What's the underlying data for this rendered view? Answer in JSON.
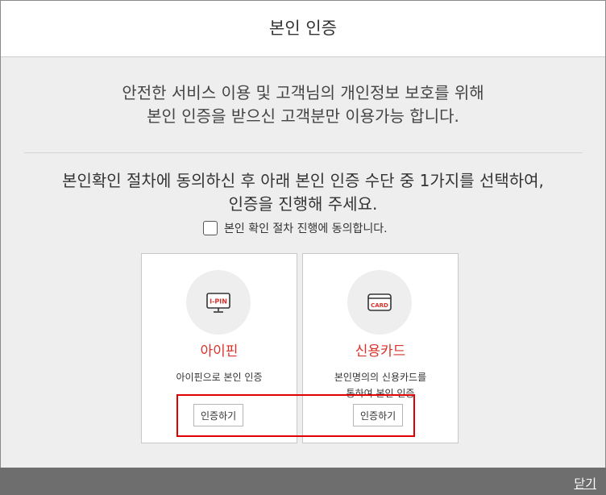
{
  "dialog": {
    "title": "본인 인증"
  },
  "intro": {
    "line1": "안전한 서비스 이용 및 고객님의 개인정보 보호를 위해",
    "line2": "본인 인증을 받으신 고객분만 이용가능 합니다."
  },
  "instruction": {
    "line1": "본인확인 절차에 동의하신 후 아래 본인 인증 수단 중 1가지를 선택하여,",
    "line2": "인증을 진행해 주세요."
  },
  "agreement": {
    "label": "본인 확인 절차 진행에 동의합니다.",
    "checked": false
  },
  "methods": [
    {
      "icon": "ipin-icon",
      "icon_text": "I-PIN",
      "name": "아이핀",
      "desc_line1": "아이핀으로 본인 인증",
      "desc_line2": "",
      "button": "인증하기"
    },
    {
      "icon": "credit-card-icon",
      "icon_text": "CARD",
      "name": "신용카드",
      "desc_line1": "본인명의의 신용카드를",
      "desc_line2": "통하여 본인 인증",
      "button": "인증하기"
    }
  ],
  "footer": {
    "close": "닫기"
  },
  "colors": {
    "accent": "#d9322b",
    "highlight": "#e00000",
    "footer_bg": "#6e6e6e",
    "page_bg": "#eeeeee"
  }
}
